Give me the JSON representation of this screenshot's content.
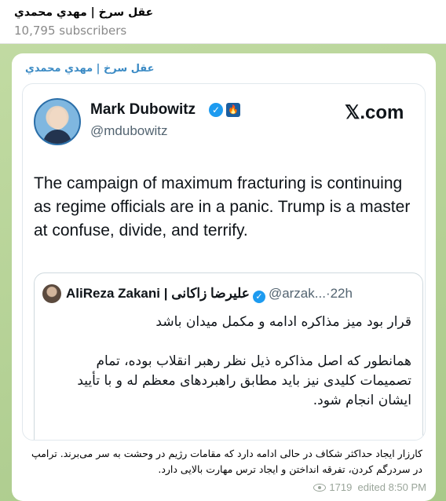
{
  "channel": {
    "title": "عقل سرخ | مهدي محمدي",
    "subscribers": "10,795 subscribers"
  },
  "post": {
    "channel_name": "عقل سرخ | مهدي محمدي",
    "tweet": {
      "author_name": "Mark Dubowitz",
      "author_handle": "@mdubowitz",
      "source": "𝕏.com",
      "text": "The campaign of maximum fracturing is continuing as regime officials are in a panic. Trump is a master at confuse, divide, and terrify.",
      "quote": {
        "author_name": "AliReza Zakani | علیرضا زاکانی",
        "author_handle": "@arzak...",
        "time": "·22h",
        "paragraphs": [
          "قرار بود میز مذاکره ادامه و مکمل میدان باشد",
          "همانطور که اصل مذاکره ذیل نظر رهبر انقلاب بوده، تمام تصمیمات کلیدی نیز باید مطابق راهبردهای معظم له و با تأیید ایشان انجام شود."
        ]
      }
    },
    "caption": "کارزار ایجاد حداکثر شکاف در حالی ادامه دارد که مقامات رژیم در وحشت به سر می‌برند. ترامپ در سردرگم کردن، تفرقه انداختن و ایجاد ترس مهارت بالایی دارد.",
    "views": "1719",
    "edited": "edited 8:50 PM"
  },
  "colors": {
    "accent": "#3a8ac4",
    "verified": "#1d9bf0",
    "background": "#b7d39a"
  },
  "icons": {
    "verified": "verified-badge-icon",
    "org": "organization-badge-icon",
    "views": "eye-icon"
  }
}
